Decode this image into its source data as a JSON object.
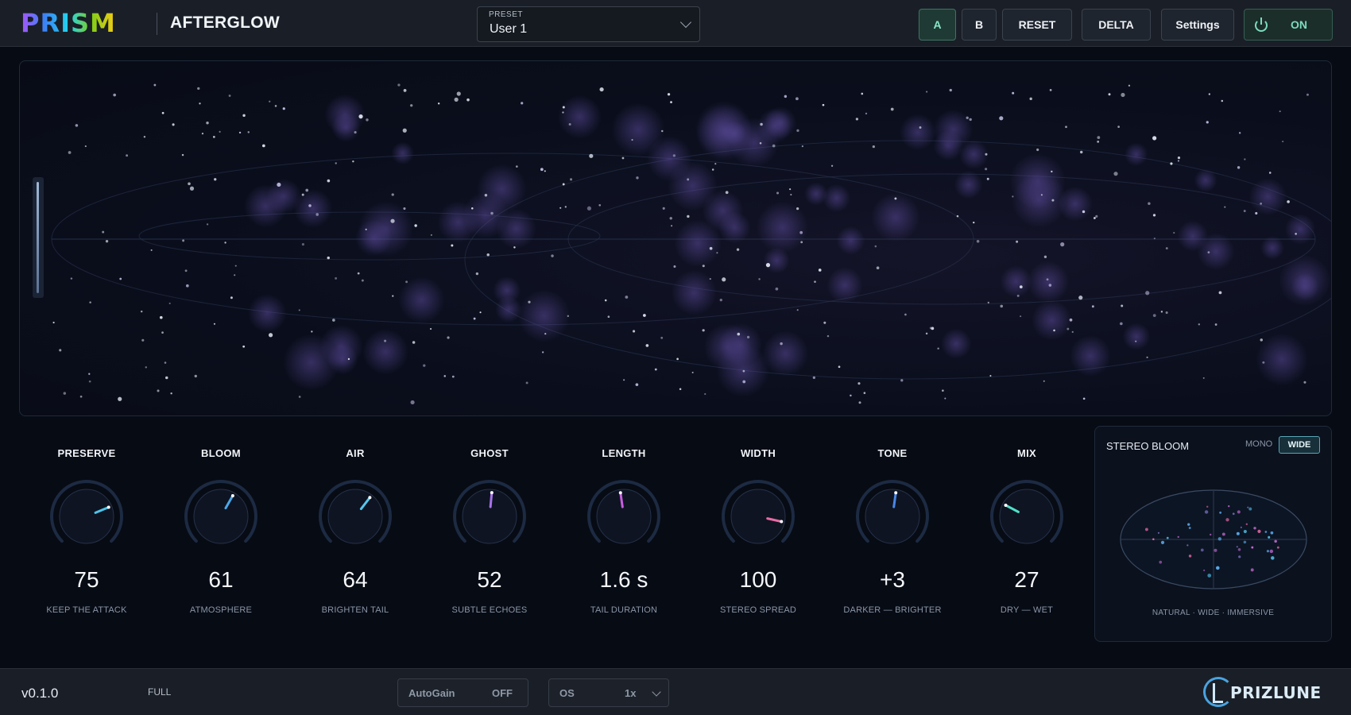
{
  "header": {
    "logo_text": "PRISM",
    "product_name": "AFTERGLOW",
    "preset": {
      "label": "PRESET",
      "value": "User 1"
    },
    "buttons": {
      "a": "A",
      "b": "B",
      "reset": "RESET",
      "delta": "DELTA",
      "settings": "Settings",
      "power": "ON"
    }
  },
  "knobs": [
    {
      "title": "PRESERVE",
      "value": "75",
      "subtitle": "KEEP THE ATTACK",
      "level": 0.75,
      "color": "#4fc3e8"
    },
    {
      "title": "BLOOM",
      "value": "61",
      "subtitle": "ATMOSPHERE",
      "level": 0.61,
      "color": "#4aa8ea"
    },
    {
      "title": "AIR",
      "value": "64",
      "subtitle": "BRIGHTEN TAIL",
      "level": 0.64,
      "color": "#56c6ea"
    },
    {
      "title": "GHOST",
      "value": "52",
      "subtitle": "SUBTLE ECHOES",
      "level": 0.52,
      "color": "#a773ea"
    },
    {
      "title": "LENGTH",
      "value": "1.6 s",
      "subtitle": "TAIL DURATION",
      "level": 0.47,
      "color": "#c65ee0"
    },
    {
      "title": "WIDTH",
      "value": "100",
      "subtitle": "STEREO SPREAD",
      "level": 0.88,
      "color": "#e86aa6"
    },
    {
      "title": "TONE",
      "value": "+3",
      "subtitle": "DARKER — BRIGHTER",
      "level": 0.53,
      "color": "#4a86e8"
    },
    {
      "title": "MIX",
      "value": "27",
      "subtitle": "DRY — WET",
      "level": 0.27,
      "color": "#4fe0c8"
    }
  ],
  "stereo": {
    "title": "STEREO BLOOM",
    "modes": {
      "mono": "MONO",
      "wide": "WIDE"
    },
    "selected_mode": "WIDE",
    "caption": "NATURAL · WIDE · IMMERSIVE"
  },
  "footer": {
    "version": "v0.1.0",
    "quality": "FULL",
    "autogain": {
      "label": "AutoGain",
      "state": "OFF"
    },
    "oversampling": {
      "label": "OS",
      "value": "1x"
    },
    "brand": "PRIZLUNE"
  },
  "colors": {
    "accent": "#7ddbbd",
    "background": "#070b14",
    "panel": "#1a1f27"
  }
}
